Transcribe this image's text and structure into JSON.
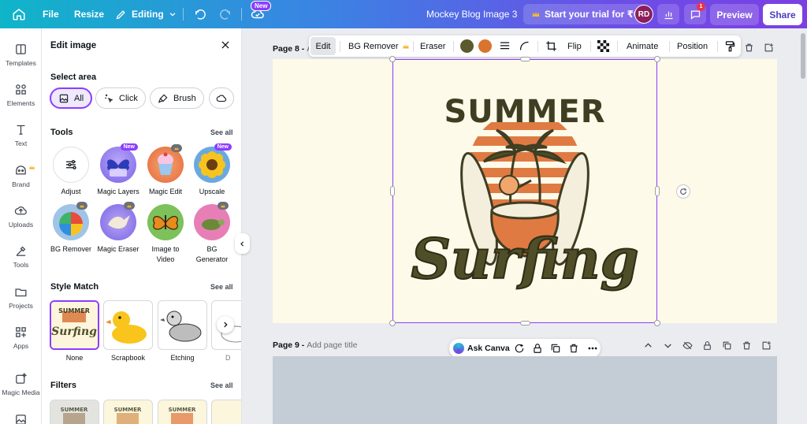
{
  "topbar": {
    "file": "File",
    "resize": "Resize",
    "mode": "Editing",
    "new_badge": "New",
    "doc_title": "Mockey Blog Image 3",
    "trial": "Start your trial for ₹0",
    "avatar": "RD",
    "comment_count": "1",
    "preview": "Preview",
    "share": "Share"
  },
  "rail": {
    "items": [
      {
        "label": "Templates",
        "icon": "templates-icon"
      },
      {
        "label": "Elements",
        "icon": "elements-icon"
      },
      {
        "label": "Text",
        "icon": "text-icon"
      },
      {
        "label": "Brand",
        "icon": "brand-icon"
      },
      {
        "label": "Uploads",
        "icon": "uploads-icon"
      },
      {
        "label": "Tools",
        "icon": "tools-icon"
      },
      {
        "label": "Projects",
        "icon": "projects-icon"
      },
      {
        "label": "Apps",
        "icon": "apps-icon"
      },
      {
        "label": "Magic Media",
        "icon": "magic-media-icon"
      }
    ]
  },
  "panel": {
    "title": "Edit image",
    "select_area": {
      "title": "Select area",
      "options": [
        "All",
        "Click",
        "Brush"
      ]
    },
    "tools": {
      "title": "Tools",
      "see_all": "See all",
      "items": [
        {
          "label": "Adjust"
        },
        {
          "label": "Magic Layers",
          "badge": "New"
        },
        {
          "label": "Magic Edit"
        },
        {
          "label": "Upscale",
          "badge": "New"
        },
        {
          "label": "BG Remover"
        },
        {
          "label": "Magic Eraser"
        },
        {
          "label": "Image to Video"
        },
        {
          "label": "BG Generator"
        }
      ]
    },
    "style_match": {
      "title": "Style Match",
      "see_all": "See all",
      "items": [
        "None",
        "Scrapbook",
        "Etching",
        "D"
      ]
    },
    "filters": {
      "title": "Filters",
      "see_all": "See all"
    }
  },
  "canvas": {
    "page8_label": "Page 8 -",
    "page8_sub": "A",
    "page9_label": "Page 9 -",
    "page9_sub": "Add page title",
    "ask_canva": "Ask Canva"
  },
  "float_toolbar": {
    "edit": "Edit",
    "bg_remover": "BG Remover",
    "eraser": "Eraser",
    "flip": "Flip",
    "animate": "Animate",
    "position": "Position",
    "colors": [
      "#5b5a2e",
      "#d9742f"
    ]
  },
  "artwork": {
    "top_text": "SUMMER",
    "script_text": "Surfing"
  },
  "colors": {
    "accent": "#8b3dff",
    "page8_bg": "#fdfae9",
    "page9_bg": "#c4ccd6"
  }
}
